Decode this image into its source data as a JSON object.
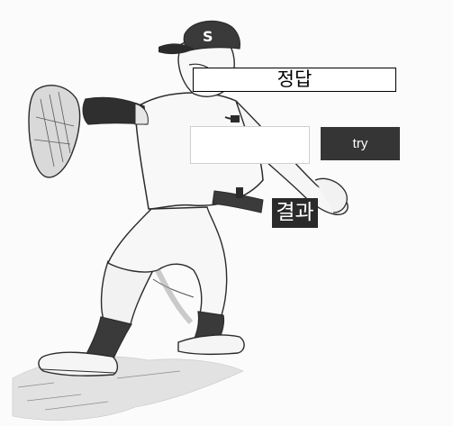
{
  "answer": {
    "label": "정답"
  },
  "guess": {
    "value": "",
    "placeholder": ""
  },
  "try_button": {
    "label": "try"
  },
  "result": {
    "label": "결과"
  },
  "background": {
    "illustration": "baseball-pitcher-sketch",
    "cap_letter": "S"
  },
  "colors": {
    "page": "#fbfbfb",
    "button": "#353535",
    "result": "#2a2a2a",
    "ink": "#2b2b2b"
  }
}
